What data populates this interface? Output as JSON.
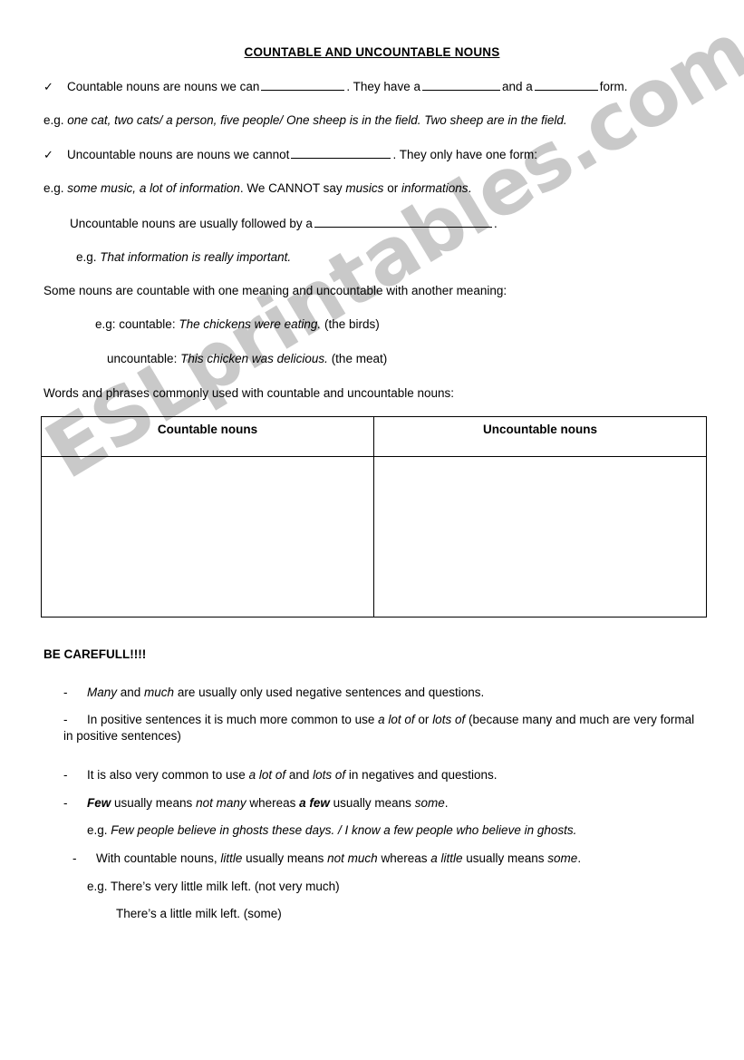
{
  "document": {
    "title": "COUNTABLE AND UNCOUNTABLE NOUNS",
    "watermark": "ESLprintables.com",
    "watermark_color": "#c9c9c9",
    "page_background": "#ffffff",
    "text_color": "#000000"
  },
  "section_countable": {
    "bullet_icon": "check-mark-icon",
    "bullet_glyph": "✓",
    "rule_part1": "Countable nouns are nouns we can",
    "rule_part2": ". They have a",
    "rule_part3": "and a",
    "rule_part4": "form.",
    "example_label": "e.g.",
    "example_text": "one cat, two cats/ a person, five people/ One sheep is in the field. Two sheep are in the field."
  },
  "section_uncountable": {
    "bullet_icon": "check-mark-icon",
    "bullet_glyph": "✓",
    "rule_part1": "Uncountable nouns are nouns we cannot",
    "rule_part2": ". They only have one form:",
    "example_label": "e.g.",
    "example_italic": "some music, a lot of information",
    "example_mid": ". We CANNOT say",
    "example_italic2": "musics",
    "example_or": "or",
    "example_italic3": "informations",
    "example_end": ".",
    "followed_by": "Uncountable nouns are usually followed by a",
    "followed_by_end": ".",
    "sub_example_label": "e.g.",
    "sub_example_text": "That information is really important."
  },
  "section_both": {
    "intro": "Some nouns are countable with one meaning and uncountable with another meaning:",
    "countable_label": "e.g: countable:",
    "countable_italic": "The chickens were eating.",
    "countable_gloss": "(the birds)",
    "uncountable_label": "uncountable:",
    "uncountable_italic": "This chicken was delicious.",
    "uncountable_gloss": "(the meat)",
    "table_intro": "Words and phrases commonly used with countable and uncountable nouns:"
  },
  "table": {
    "headers": [
      "Countable nouns",
      "Uncountable nouns"
    ],
    "rows": [
      [
        "",
        ""
      ]
    ]
  },
  "section_careful": {
    "heading": "BE CAREFULL!!!!",
    "dash_glyph": "-",
    "items": [
      {
        "id": "many-much",
        "parts": [
          {
            "t": "Many",
            "s": "i"
          },
          {
            "t": " and ",
            "s": "n"
          },
          {
            "t": "much",
            "s": "i"
          },
          {
            "t": " are usually only used negative sentences and questions.",
            "s": "n"
          }
        ]
      },
      {
        "id": "positive-sentences",
        "parts": [
          {
            "t": "In positive sentences it is much more common to use ",
            "s": "n"
          },
          {
            "t": "a lot of",
            "s": "i"
          },
          {
            "t": " or ",
            "s": "n"
          },
          {
            "t": "lots of",
            "s": "i"
          },
          {
            "t": " (because many and much are very formal in positive sentences)",
            "s": "n"
          }
        ]
      },
      {
        "id": "negatives-questions",
        "parts": [
          {
            "t": "It is also very common to use ",
            "s": "n"
          },
          {
            "t": "a lot of",
            "s": "i"
          },
          {
            "t": " and ",
            "s": "n"
          },
          {
            "t": "lots of",
            "s": "i"
          },
          {
            "t": " in negatives and questions.",
            "s": "n"
          }
        ]
      },
      {
        "id": "few-a-few",
        "parts": [
          {
            "t": "Few",
            "s": "bi"
          },
          {
            "t": " usually means ",
            "s": "n"
          },
          {
            "t": "not many",
            "s": "i"
          },
          {
            "t": " whereas ",
            "s": "n"
          },
          {
            "t": "a few",
            "s": "bi"
          },
          {
            "t": " usually means ",
            "s": "n"
          },
          {
            "t": "some",
            "s": "i"
          },
          {
            "t": ".",
            "s": "n"
          }
        ]
      }
    ],
    "few_example_label": "e.g.",
    "few_example_text": "Few people believe in ghosts these days. / I know a few people who believe in ghosts.",
    "little_item": {
      "id": "little-a-little",
      "parts": [
        {
          "t": "With countable nouns, ",
          "s": "n"
        },
        {
          "t": "little",
          "s": "i"
        },
        {
          "t": " usually means ",
          "s": "n"
        },
        {
          "t": "not much",
          "s": "i"
        },
        {
          "t": " whereas ",
          "s": "n"
        },
        {
          "t": "a little",
          "s": "i"
        },
        {
          "t": " usually means ",
          "s": "n"
        },
        {
          "t": "some",
          "s": "i"
        },
        {
          "t": ".",
          "s": "n"
        }
      ]
    },
    "little_example_1": "e.g. There’s very little milk left. (not very much)",
    "little_example_2": "There’s a little milk left. (some)"
  }
}
